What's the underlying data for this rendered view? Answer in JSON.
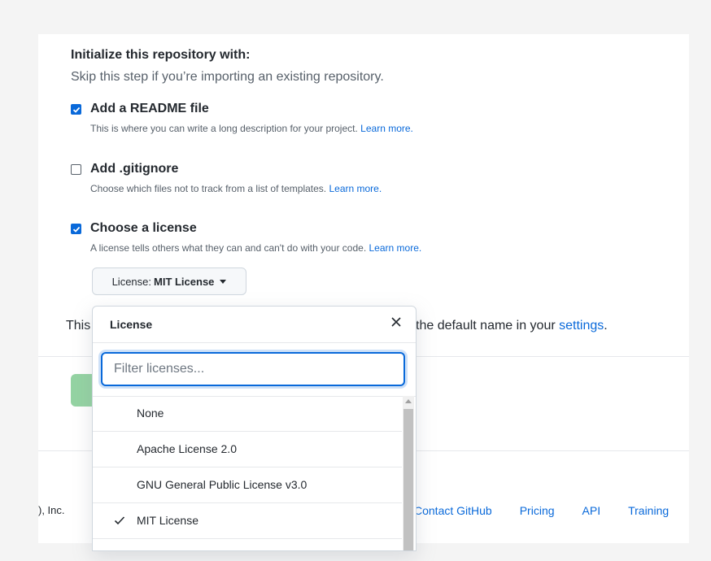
{
  "init": {
    "heading": "Initialize this repository with:",
    "subheading": "Skip this step if you’re importing an existing repository."
  },
  "options": [
    {
      "title": "Add a README file",
      "desc": "This is where you can write a long description for your project.",
      "link": "Learn more.",
      "checked": true
    },
    {
      "title": "Add .gitignore",
      "desc": "Choose which files not to track from a list of templates.",
      "link": "Learn more.",
      "checked": false
    },
    {
      "title": "Choose a license",
      "desc": "A license tells others what they can and can't do with your code.",
      "link": "Learn more.",
      "checked": true
    }
  ],
  "license_button": {
    "prefix": "License:",
    "value": "MIT License"
  },
  "behind_text": {
    "left": "This",
    "right": "the default name in your",
    "link": "settings",
    "end": "."
  },
  "footer": {
    "left": "), Inc.",
    "links": [
      "Contact GitHub",
      "Pricing",
      "API",
      "Training"
    ]
  },
  "dropdown": {
    "title": "License",
    "filter_placeholder": "Filter licenses...",
    "filter_value": "",
    "items": [
      {
        "label": "None",
        "selected": false
      },
      {
        "label": "Apache License 2.0",
        "selected": false
      },
      {
        "label": "GNU General Public License v3.0",
        "selected": false
      },
      {
        "label": "MIT License",
        "selected": true
      }
    ]
  },
  "colors": {
    "accent": "#0969da",
    "primary_button": "#94d3a2"
  }
}
